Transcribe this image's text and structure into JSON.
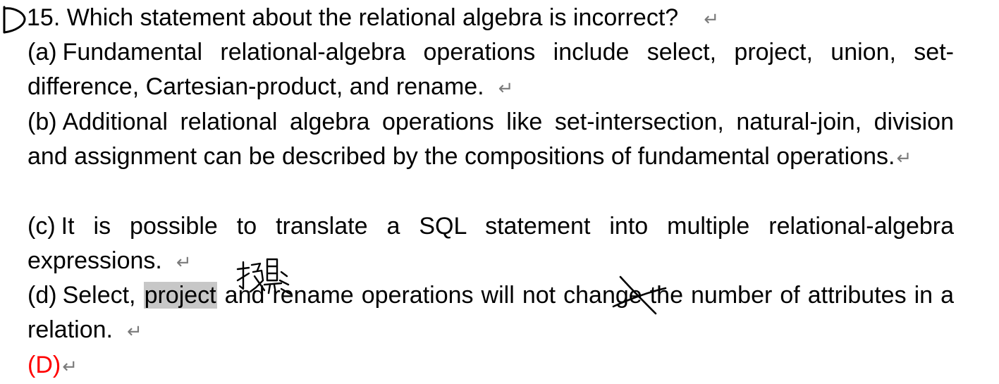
{
  "question": {
    "number": "15.",
    "text": "Which statement about the relational algebra is incorrect?",
    "return_mark": "↵"
  },
  "options": {
    "a": {
      "label": "(a)",
      "text": "Fundamental relational-algebra operations include select, project, union, set-difference, Cartesian-product, and rename."
    },
    "b": {
      "label": "(b)",
      "text": "Additional relational algebra operations like set-intersection, natural-join, division and assignment can be described by the compositions of fundamental operations."
    },
    "c": {
      "label": "(c)",
      "text": "It is possible to translate a SQL statement into multiple relational-algebra expressions."
    },
    "d": {
      "label": "(d)",
      "before": "Select,",
      "highlight": "project",
      "middle": "and rename operations will",
      "struck": "not",
      "after": "change the number of attributes in a relation."
    }
  },
  "answer": {
    "text": "(D)",
    "color": "#ff0000"
  },
  "annotations": {
    "margin_mark": "D",
    "handwritten_note": "投影",
    "highlight_color": "#c7c7c7"
  }
}
